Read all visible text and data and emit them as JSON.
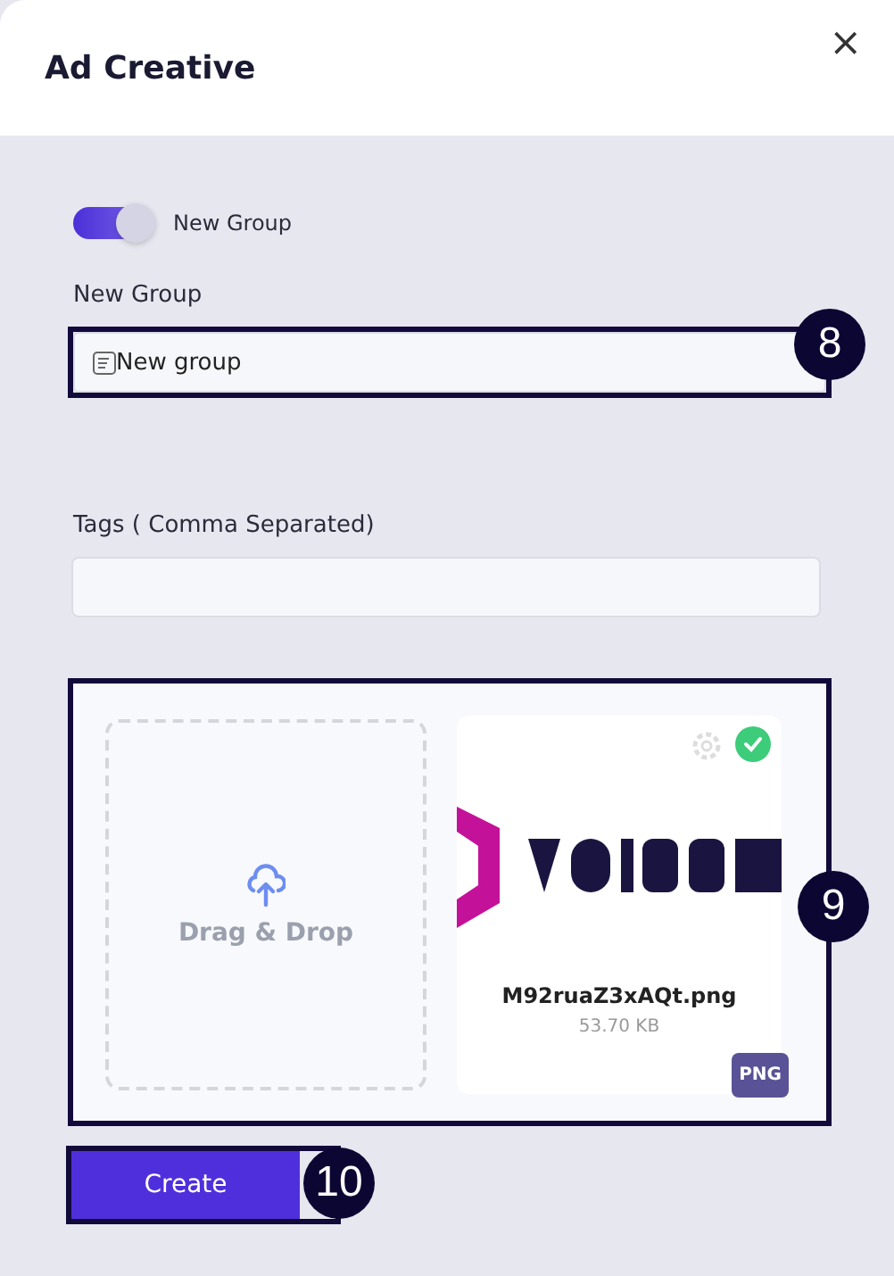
{
  "dialog": {
    "title": "Ad Creative",
    "close": "×"
  },
  "toggle": {
    "label": "New Group",
    "on": true
  },
  "group_field": {
    "label": "New Group",
    "value": "New group",
    "callout": "8"
  },
  "tags_field": {
    "label": "Tags ( Comma Separated)"
  },
  "upload": {
    "callout": "9",
    "dropzone": "Drag & Drop",
    "file": {
      "kind": "picture",
      "name": "M92ruaZ3xAQt.png",
      "size": "53.70 KB",
      "type": "PNG",
      "verified": true
    }
  },
  "create_button": {
    "label": "Create",
    "callout": "10"
  }
}
